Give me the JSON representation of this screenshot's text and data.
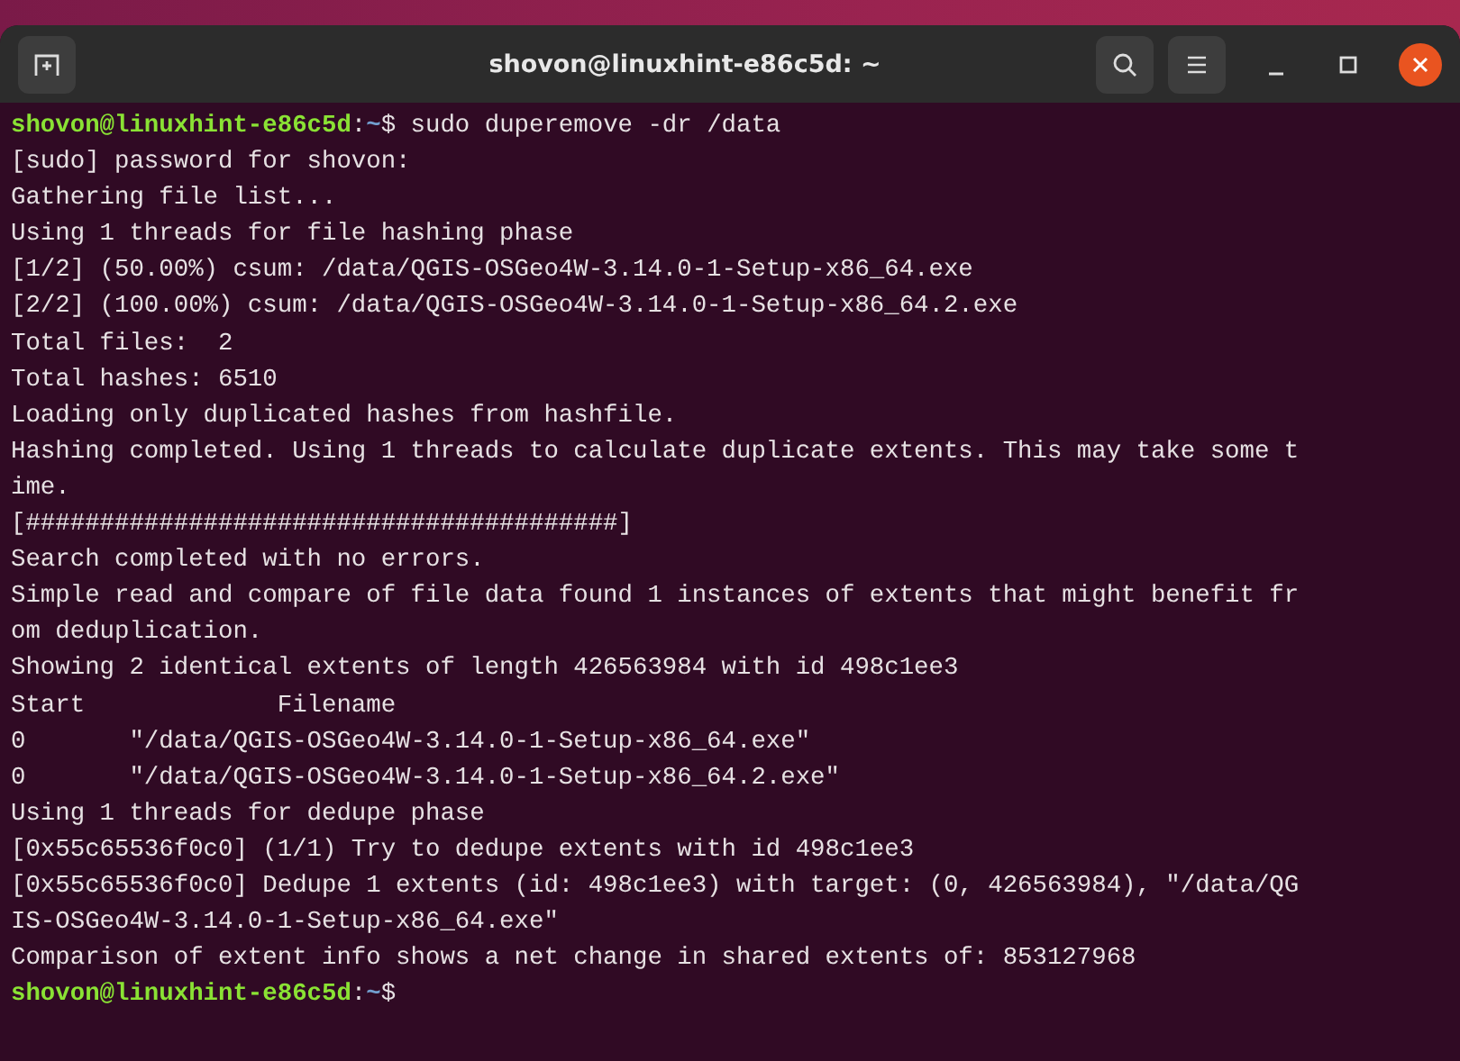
{
  "window": {
    "title": "shovon@linuxhint-e86c5d: ~"
  },
  "lines": [
    {
      "kind": "prompt",
      "user": "shovon@linuxhint-e86c5d",
      "separator": ":",
      "path": "~",
      "command": "$ sudo duperemove -dr /data"
    },
    {
      "kind": "output",
      "text": "[sudo] password for shovon:"
    },
    {
      "kind": "output",
      "text": "Gathering file list..."
    },
    {
      "kind": "output",
      "text": "Using 1 threads for file hashing phase"
    },
    {
      "kind": "output",
      "text": "[1/2] (50.00%) csum: /data/QGIS-OSGeo4W-3.14.0-1-Setup-x86_64.exe"
    },
    {
      "kind": "output",
      "text": "[2/2] (100.00%) csum: /data/QGIS-OSGeo4W-3.14.0-1-Setup-x86_64.2.exe"
    },
    {
      "kind": "output",
      "text": "Total files:  2"
    },
    {
      "kind": "output",
      "text": "Total hashes: 6510"
    },
    {
      "kind": "output",
      "text": "Loading only duplicated hashes from hashfile."
    },
    {
      "kind": "output",
      "text": "Hashing completed. Using 1 threads to calculate duplicate extents. This may take some t"
    },
    {
      "kind": "output",
      "text": "ime."
    },
    {
      "kind": "output",
      "text": "[########################################]"
    },
    {
      "kind": "output",
      "text": "Search completed with no errors."
    },
    {
      "kind": "output",
      "text": "Simple read and compare of file data found 1 instances of extents that might benefit fr"
    },
    {
      "kind": "output",
      "text": "om deduplication."
    },
    {
      "kind": "output",
      "text": "Showing 2 identical extents of length 426563984 with id 498c1ee3"
    },
    {
      "kind": "output",
      "text": "Start             Filename"
    },
    {
      "kind": "output",
      "text": "0       \"/data/QGIS-OSGeo4W-3.14.0-1-Setup-x86_64.exe\""
    },
    {
      "kind": "output",
      "text": "0       \"/data/QGIS-OSGeo4W-3.14.0-1-Setup-x86_64.2.exe\""
    },
    {
      "kind": "output",
      "text": "Using 1 threads for dedupe phase"
    },
    {
      "kind": "output",
      "text": "[0x55c65536f0c0] (1/1) Try to dedupe extents with id 498c1ee3"
    },
    {
      "kind": "output",
      "text": "[0x55c65536f0c0] Dedupe 1 extents (id: 498c1ee3) with target: (0, 426563984), \"/data/QG"
    },
    {
      "kind": "output",
      "text": "IS-OSGeo4W-3.14.0-1-Setup-x86_64.exe\""
    },
    {
      "kind": "output",
      "text": "Comparison of extent info shows a net change in shared extents of: 853127968"
    },
    {
      "kind": "prompt",
      "user": "shovon@linuxhint-e86c5d",
      "separator": ":",
      "path": "~",
      "command": "$"
    }
  ]
}
